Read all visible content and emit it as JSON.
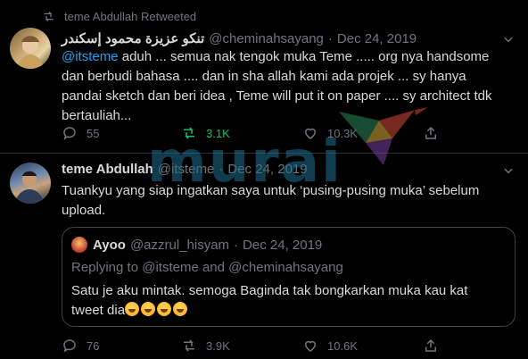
{
  "retweet_banner": {
    "text": "teme Abdullah Retweeted"
  },
  "tweet1": {
    "name": "تنكو عزيزة محمود إسكندر",
    "handle": "@cheminahsayang",
    "separator": "·",
    "date": "Dec 24, 2019",
    "mention": "@itsteme",
    "text": " aduh ... semua nak tengok muka Teme ..... org nya handsome dan berbudi bahasa .... dan in sha allah kami ada projek ... sy hanya pandai sketch dan beri idea , Teme will put it on paper .... sy architect tdk bertauliah...",
    "replies": "55",
    "retweets": "3.1K",
    "likes": "10.3K"
  },
  "tweet2": {
    "name": "teme Abdullah",
    "handle": "@itsteme",
    "separator": "·",
    "date": "Dec 24, 2019",
    "text": "Tuankyu yang siap ingatkan saya untuk ‘pusing-pusing muka’ sebelum upload.",
    "replies": "76",
    "retweets": "3.9K",
    "likes": "10.6K"
  },
  "quote": {
    "name": "Ayoo",
    "handle": "@azzrul_hisyam",
    "separator": "·",
    "date": "Dec 24, 2019",
    "reply_prefix": "Replying to ",
    "reply_to_1": "@itsteme",
    "reply_and": " and ",
    "reply_to_2": "@cheminahsayang",
    "text": "Satu je aku mintak. semoga Baginda tak bongkarkan muka kau kat tweet dia"
  },
  "watermark": {
    "text": "murai"
  },
  "colors": {
    "background": "#000000",
    "accent": "#1da1f2",
    "retweet_active": "#17bf63",
    "muted": "#6e767d"
  }
}
